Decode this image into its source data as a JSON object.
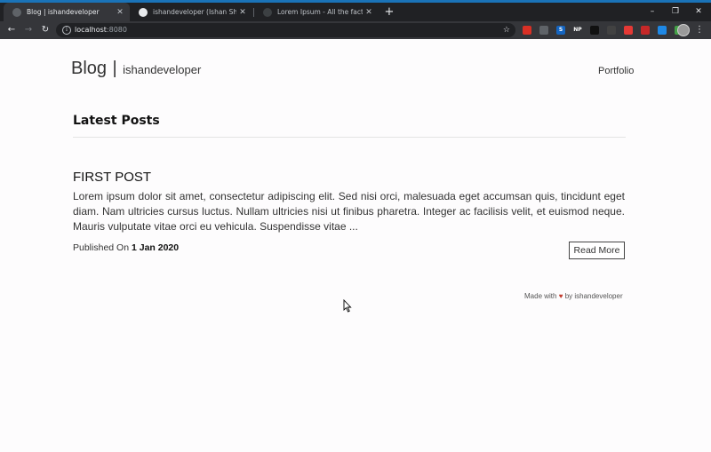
{
  "browser": {
    "tabs": [
      {
        "title": "Blog | ishandeveloper",
        "active": true
      },
      {
        "title": "ishandeveloper (Ishan Sharma)",
        "active": false
      },
      {
        "title": "Lorem Ipsum - All the facts - Lips",
        "active": false
      }
    ],
    "new_tab_label": "+",
    "window_controls": {
      "minimize": "–",
      "restore": "❐",
      "close": "✕"
    },
    "address": {
      "host": "localhost",
      "port": ":8080"
    },
    "extensions": [
      {
        "name": "ext-red-icon",
        "glyph": "",
        "color": "#d93025"
      },
      {
        "name": "ext-keep-icon",
        "glyph": "",
        "color": "#5f6368"
      },
      {
        "name": "ext-s-icon",
        "glyph": "S",
        "color": "#1565c0"
      },
      {
        "name": "ext-np-icon",
        "glyph": "NP",
        "color": "#35363a"
      },
      {
        "name": "ext-cat-icon",
        "glyph": "",
        "color": "#111111"
      },
      {
        "name": "ext-robot-icon",
        "glyph": "",
        "color": "#424242"
      },
      {
        "name": "ext-flag-icon",
        "glyph": "",
        "color": "#e53935"
      },
      {
        "name": "ext-figure-icon",
        "glyph": "",
        "color": "#c62828"
      },
      {
        "name": "ext-dropbox-icon",
        "glyph": "",
        "color": "#1e88e5"
      },
      {
        "name": "ext-shield-icon",
        "glyph": "",
        "color": "#43a047"
      }
    ],
    "colors": {
      "tabbar": "#202124",
      "toolbar": "#35363a",
      "accent": "#1a73b8"
    }
  },
  "site": {
    "brand_main": "Blog",
    "brand_sep": "|",
    "brand_sub": "ishandeveloper",
    "nav_portfolio": "Portfolio"
  },
  "main": {
    "section_title": "Latest Posts",
    "post": {
      "title": "FIRST POST",
      "excerpt": "Lorem ipsum dolor sit amet, consectetur adipiscing elit. Sed nisi orci, malesuada eget accumsan quis, tincidunt eget diam. Nam ultricies cursus luctus. Nullam ultricies nisi ut finibus pharetra. Integer ac facilisis velit, et euismod neque. Mauris vulputate vitae orci eu vehicula. Suspendisse vitae ...",
      "published_label": "Published On",
      "published_date": "1 Jan 2020",
      "read_more": "Read More"
    }
  },
  "footer": {
    "made_with": "Made with",
    "heart": "♥",
    "by": "by ishandeveloper",
    "heart_color": "#c0392b"
  }
}
